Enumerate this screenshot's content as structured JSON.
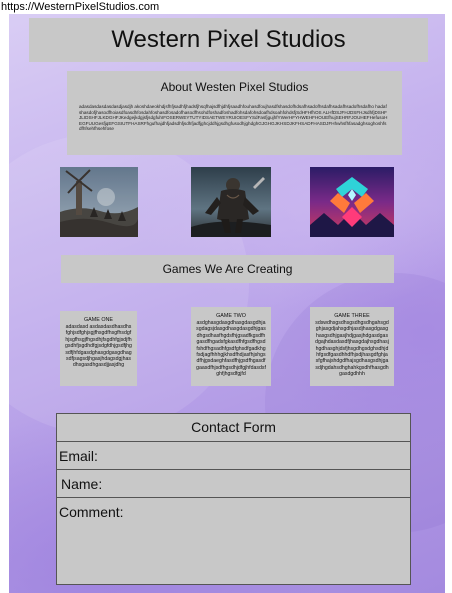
{
  "browser": {
    "url": "https://WesternPixelStudios.com"
  },
  "header": {
    "title": "Western Pixel Studios"
  },
  "about": {
    "heading": "About Westen Pixel Studios",
    "body": "adasdasdasdasdasdjasdjh akoshdaeokhdjsfhfjsadhfjhadsfjhsqfhajsdfhjdhfjsaadhfouhasdfoujhasdfshasdofhdsafhsadofhsdafhsadafhsadofhsdafho hadafshasdofjhasodfhoiasdfoasdhfosdahfoshasdfosadofhasodfhsohdfoshadfoshadfohsdafohsdoafhdsoahfohdsfjSdHFHfhOS ALHfDSJFHJDSFHJsdhfjDSHFJLIDSHFJLKDGHFJKedgejkdgjsfjsdgfuhIFOSERWEYTUTYIDSAETWEYRUIOESFYSdFasfjgujhfYWerHFYHWEHFHOUEfhujSEHRFJOUHEFHefusoHEGFUUGesfjqEFGSIUTFHASRFhgufhajdhfjadsdhfjsdhfjadfjghcjddhjgsdhgfusodhjghdghGJGHGJKHSDJKFHSADFHASDJFHhwhsfhfasadghsoghoshfsdfhfsehfhsehfose"
  },
  "images": [
    {
      "name": "windmill-battlefield-image"
    },
    {
      "name": "viking-warrior-image"
    },
    {
      "name": "neon-logo-image"
    }
  ],
  "games_section": {
    "heading": "Games We Are Creating"
  },
  "games": [
    {
      "title": "GAME ONE",
      "desc": "adasdasd asdasdasdhasdhsfghjsdfghjsgjfhsgdfhsgfhsdgfhjsgfhsgjfhgsdhjfsgdhfgjsdjfhgsdhfjsgdhdfgjsdgfdhjgsdfjhgsdfjhfdgasdghasgdgasgdhagsdfjsagsdjhgasjhdagsdgjhasdhsgasdhgasdjjasjdhg"
    },
    {
      "title": "GAME TWO",
      "desc": "asdghasgdasgdhasgdasgdhjasgdagsjdasgdhasgdasgdhjgasdhgsdhasfhgdsfhjgsadfkgsdfhgasdfhgadsfgkasdfhfgsdfhgsdfshdfhgsadhfgsdfghsdfgadkhgfsdjagfhhhgjkhsdfhdjasfhjshgsdfhjgsdaeghfasdfhjgsdfhgasdfgaasdfhjsdfhgsdhjdfgjhfdasdsfghfjhgsdfgjfd"
    },
    {
      "title": "GAME THREE",
      "desc": "sdswdhsgsdhsgsdhgsdhgahsgdghjasgdjahsgdhjasdjhasgdgasghasgsdhjgasjhdjgasjhdgasdgasdgajhdasdasdfjhasgdajhsgdhasjhgdhasghjdsfjhsgdhgsdghsdhjdhfgsdfgasdhhdfhjsdjhasgdfghjasfgfhajshdgdfhajsgdhasgsdhjgasdjhgdahsdhghahkgsdhfhasgdhgasdgdhhh"
    }
  ],
  "contact": {
    "title": "Contact Form",
    "email_label": "Email:",
    "name_label": "Name:",
    "comment_label": "Comment:"
  }
}
